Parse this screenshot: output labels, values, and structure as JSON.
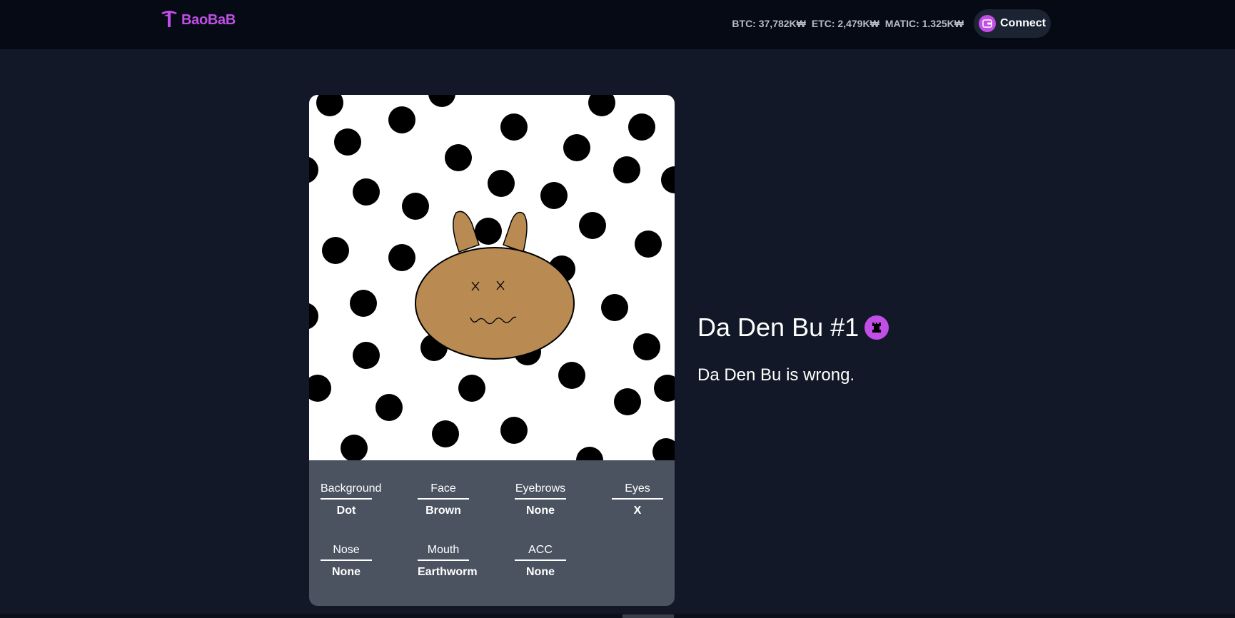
{
  "header": {
    "brand": "BaoBaB",
    "prices": {
      "btc": "BTC: 37,782K₩",
      "etc": "ETC: 2,479K₩",
      "matic": "MATIC: 1.325K₩"
    },
    "connect_label": "Connect"
  },
  "nft": {
    "title": "Da Den Bu #1",
    "description": "Da Den Bu is wrong.",
    "traits": [
      {
        "name": "Background",
        "value": "Dot"
      },
      {
        "name": "Face",
        "value": "Brown"
      },
      {
        "name": "Eyebrows",
        "value": "None"
      },
      {
        "name": "Eyes",
        "value": "X"
      },
      {
        "name": "Nose",
        "value": "None"
      },
      {
        "name": "Mouth",
        "value": "Earthworm"
      },
      {
        "name": "ACC",
        "value": "None"
      }
    ]
  },
  "colors": {
    "accent": "#c14ee6",
    "page_bg": "#121827",
    "header_bg": "#050a14",
    "trait_panel": "#4b5361",
    "face": "#b98a52"
  },
  "icons": [
    "baobab-tree-logo-icon",
    "wallet-icon",
    "rook-badge-icon"
  ]
}
